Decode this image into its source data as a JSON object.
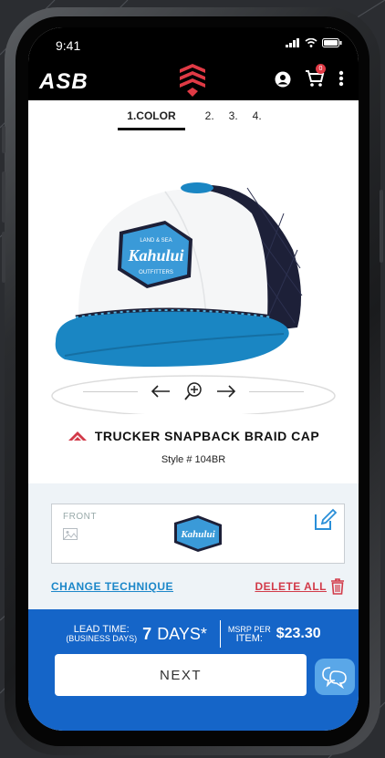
{
  "status": {
    "time": "9:41"
  },
  "header": {
    "logo": "ASB",
    "cart_count": "0"
  },
  "steps": [
    {
      "label": "1.COLOR",
      "active": true
    },
    {
      "label": "2."
    },
    {
      "label": "3."
    },
    {
      "label": "4."
    }
  ],
  "product": {
    "patch_top": "LAND & SEA",
    "patch_main": "Kahului",
    "patch_bottom": "OUTFITTERS",
    "title": "TRUCKER SNAPBACK BRAID CAP",
    "style_label": "Style #",
    "style_number": "104BR"
  },
  "design": {
    "front_label": "FRONT",
    "change_technique": "CHANGE TECHNIQUE",
    "delete_all": "DELETE ALL"
  },
  "footer": {
    "lead_time_label": "LEAD TIME:",
    "lead_time_sub": "(BUSINESS DAYS)",
    "lead_time_value": "7",
    "lead_time_unit": "DAYS*",
    "msrp_label_1": "MSRP PER",
    "msrp_label_2": "ITEM:",
    "price": "$23.30",
    "next_label": "NEXT"
  },
  "colors": {
    "brand_red": "#d23a49",
    "footer_blue": "#1565c8",
    "link_blue": "#1c87c9",
    "cap_blue": "#1a86c3",
    "cap_navy": "#1d2038"
  }
}
